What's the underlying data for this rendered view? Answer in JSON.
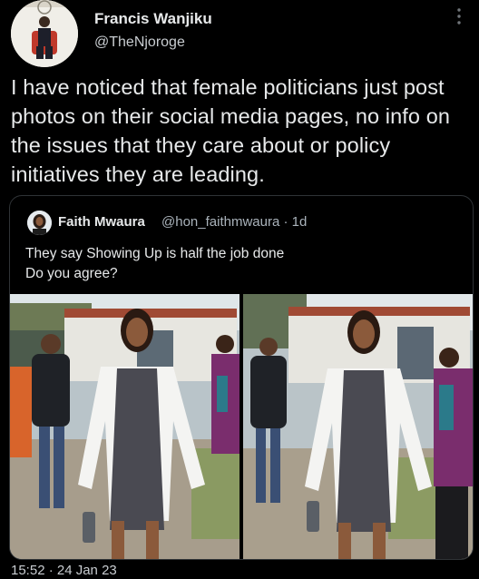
{
  "author": {
    "display_name": "Francis Wanjiku",
    "handle": "@TheNjoroge"
  },
  "tweet": {
    "text": "I have noticed that female politicians just post photos on their social media pages, no info on the issues that they care about or policy initiatives they are leading."
  },
  "quoted": {
    "name": "Faith Mwaura",
    "handle_time": "@hon_faithmwaura · 1d",
    "line1": "They say Showing Up is half the job done",
    "line2": "Do you agree?"
  },
  "timestamp": "15:52 · 24 Jan 23",
  "icons": [
    "more-vertical-icon"
  ],
  "colors": {
    "background": "#000000",
    "text": "#e7e9ea",
    "secondary_text": "#c8ccd0",
    "border": "#2f3336"
  }
}
